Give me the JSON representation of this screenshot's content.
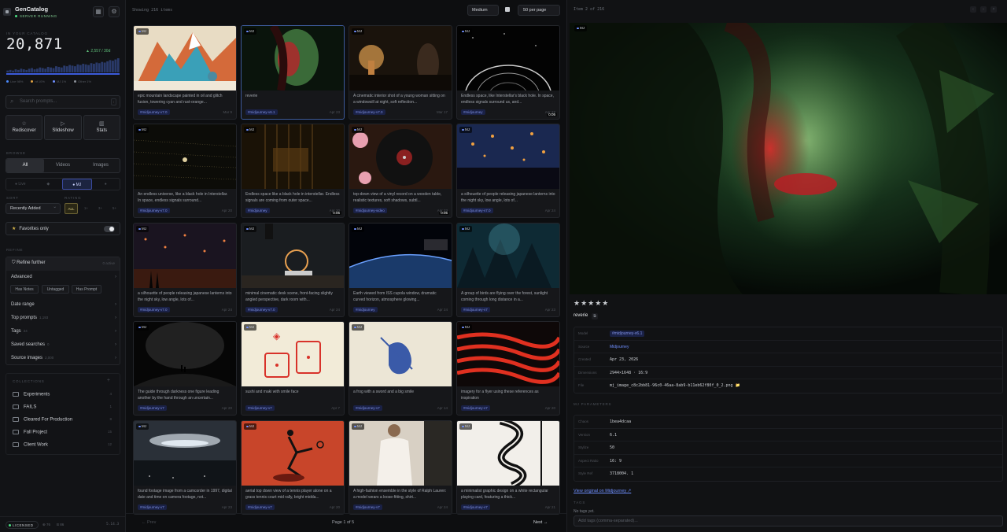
{
  "sidebar": {
    "app_name": "GenCatalog",
    "server_status": "SERVER RUNNING",
    "catalog_label": "IN YOUR CATALOG",
    "count": "20,871",
    "delta": "▲ 2,557 / 30d",
    "legend": [
      "Live 98%",
      "nf 10%",
      "MJ 1%",
      "Other 1%"
    ],
    "legend_colors": [
      "#4b8bff",
      "#e0a040",
      "#6f8fff",
      "#8a8f97"
    ],
    "sparkline": [
      3,
      4,
      3,
      5,
      4,
      6,
      5,
      4,
      6,
      7,
      5,
      6,
      8,
      7,
      6,
      9,
      8,
      7,
      10,
      9,
      8,
      11,
      10,
      12,
      11,
      10,
      13,
      12,
      14,
      13,
      12,
      15,
      14,
      16,
      15,
      17,
      16,
      18,
      20,
      19,
      21,
      23
    ],
    "search_placeholder": "Search prompts...",
    "search_kbd": "/",
    "tiles": [
      {
        "icon": "☆",
        "label": "Rediscover"
      },
      {
        "icon": "▷",
        "label": "Slideshow"
      },
      {
        "icon": "▥",
        "label": "Stats"
      }
    ],
    "browse_label": "BROWSE",
    "types": [
      "All",
      "Videos",
      "Images"
    ],
    "sources": [
      "● Live",
      "◆",
      "● MJ",
      "●"
    ],
    "sort_label": "SORT",
    "sort_value": "Recently Added",
    "rating_label": "RATING",
    "ratings": [
      "ALL",
      "1+",
      "3+",
      "5+"
    ],
    "favorites_label": "Favorites only",
    "refine_label": "REFINE",
    "refine": {
      "title": "Refine further",
      "active": "0 active",
      "advanced": "Advanced",
      "chips": [
        "Has Notes",
        "Untagged",
        "Has Prompt"
      ],
      "rows": [
        {
          "label": "Date range",
          "n": ""
        },
        {
          "label": "Top prompts",
          "n": "1,193"
        },
        {
          "label": "Tags",
          "n": "24"
        },
        {
          "label": "Saved searches",
          "n": "0"
        },
        {
          "label": "Source images",
          "n": "2,000"
        }
      ]
    },
    "collections_label": "COLLECTIONS",
    "collections": [
      {
        "name": "Experiments",
        "n": "4"
      },
      {
        "name": "FAILS",
        "n": "1"
      },
      {
        "name": "Cleared For Production",
        "n": "8"
      },
      {
        "name": "Fall Project",
        "n": "15"
      },
      {
        "name": "Client Work",
        "n": "12"
      }
    ],
    "license": "LICENSED",
    "stats": [
      "⊕ 76",
      "B 86"
    ],
    "version": "5.14.3"
  },
  "main": {
    "showing": "Showing 216 items",
    "size": "Medium",
    "per_page": "50 per page",
    "cards": [
      {
        "caption": "epic mountain landscape painted in oil and glitch fusion, towering cyan and rust-orange...",
        "tag": "#midjourney-v7.0",
        "date": "Mar 9",
        "bg": "a",
        "dur": ""
      },
      {
        "caption": "reverie",
        "tag": "#midjourney-v6.1",
        "date": "Apr 23",
        "bg": "b",
        "dur": ""
      },
      {
        "caption": "A cinematic interior shot of a young woman sitting on a windowsill at night, soft reflection...",
        "tag": "#midjourney-v7.0",
        "date": "Mar 17",
        "bg": "c",
        "dur": ""
      },
      {
        "caption": "Endless space, like Interstellar's black hole. In space, endless signals surround us, and...",
        "tag": "#midjourney",
        "date": "Apr 22",
        "bg": "d",
        "dur": "0:05"
      },
      {
        "caption": "An endless universe, like a black hole in Interstellar. In space, endless signals surround...",
        "tag": "#midjourney-v7.0",
        "date": "Apr 20",
        "bg": "e",
        "dur": ""
      },
      {
        "caption": "Endless space like a black hole in interstellar. Endless signals are coming from outer space...",
        "tag": "#midjourney",
        "date": "Apr 20",
        "bg": "f",
        "dur": "0:05"
      },
      {
        "caption": "top-down view of a vinyl record on a wooden table, realistic textures, soft shadows, subtl...",
        "tag": "#midjourney-video",
        "date": "Apr 23",
        "bg": "g",
        "dur": "0:05"
      },
      {
        "caption": "a silhouette of people releasing japanese lanterns into the night sky, low angle, lots of...",
        "tag": "#midjourney-v7.0",
        "date": "Apr 24",
        "bg": "h",
        "dur": ""
      },
      {
        "caption": "a silhouette of people releasing japanese lanterns into the night sky, low angle, lots of...",
        "tag": "#midjourney-v7.0",
        "date": "Apr 24",
        "bg": "i",
        "dur": ""
      },
      {
        "caption": "minimal cinematic desk scene, front-facing slightly angled perspective, dark room with...",
        "tag": "#midjourney-v7.0",
        "date": "Apr 24",
        "bg": "j",
        "dur": ""
      },
      {
        "caption": "Earth viewed from ISS cupola window, dramatic curved horizon, atmosphere glowing...",
        "tag": "#midjourney",
        "date": "Apr 24",
        "bg": "k",
        "dur": ""
      },
      {
        "caption": "A group of birds are flying over the forest, sunlight coming through long distance in a...",
        "tag": "#midjourney-v7",
        "date": "Apr 23",
        "bg": "l",
        "dur": ""
      },
      {
        "caption": "The guide through darkness one figure leading another by the hand through an uncertain...",
        "tag": "#midjourney-v7",
        "date": "Apr 20",
        "bg": "m",
        "dur": ""
      },
      {
        "caption": "sushi and maki with smile face",
        "tag": "#midjourney-v7",
        "date": "Apr 7",
        "bg": "n",
        "dur": ""
      },
      {
        "caption": "a frog with a sword and a big smile",
        "tag": "#midjourney-v7",
        "date": "Apr 14",
        "bg": "o",
        "dur": ""
      },
      {
        "caption": "imagery for a flyer using these references as inspiration",
        "tag": "#midjourney-v7",
        "date": "Apr 20",
        "bg": "p",
        "dur": ""
      },
      {
        "caption": "found footage image from a camcorder in 1997, digital date and time on camera footage, not...",
        "tag": "#midjourney-v7",
        "date": "Apr 23",
        "bg": "q",
        "dur": ""
      },
      {
        "caption": "aerial top down view of a tennis player alone on a grass tennis court mid rally, bright midda...",
        "tag": "#midjourney-v7",
        "date": "Apr 20",
        "bg": "r",
        "dur": ""
      },
      {
        "caption": "A high-fashion ensemble in the style of Ralph Lauren: a model wears a loose-fitting, shirt...",
        "tag": "#midjourney-v7",
        "date": "Apr 24",
        "bg": "s",
        "dur": ""
      },
      {
        "caption": "a minimalist graphic design on a white rectangular playing card, featuring a thick...",
        "tag": "#midjourney-v7",
        "date": "Apr 21",
        "bg": "t",
        "dur": ""
      }
    ],
    "pager": {
      "prev": "← Prev",
      "info": "Page 1 of 5",
      "next": "Next →"
    }
  },
  "detail": {
    "position": "Item 2 of 216",
    "badge": "MJ",
    "stars": "★★★★★",
    "title": "reverie",
    "meta": [
      {
        "k": "Model",
        "v": "#midjourney-v6.1",
        "kind": "tag"
      },
      {
        "k": "Source",
        "v": "Midjourney",
        "kind": "link"
      },
      {
        "k": "Created",
        "v": "Apr 23, 2026",
        "kind": "text"
      },
      {
        "k": "Dimensions",
        "v": "2944×1648 · 16:9",
        "kind": "text"
      },
      {
        "k": "File",
        "v": "mj_image_c8c2bb81-96c0-46aa-8ab9-b11eb62f80f_0_2.png 📁",
        "kind": "text"
      }
    ],
    "params_label": "MJ PARAMETERS",
    "params": [
      {
        "k": "Chaos",
        "v": "1bea4dcaa"
      },
      {
        "k": "Version",
        "v": "6.1"
      },
      {
        "k": "Stylize",
        "v": "50"
      },
      {
        "k": "Aspect Ratio",
        "v": "16: 9"
      },
      {
        "k": "Style Ref",
        "v": "3718004. 1"
      }
    ],
    "view_original": "View original on Midjourney ↗",
    "tags_label": "TAGS",
    "no_tags": "No tags yet.",
    "add_tags_placeholder": "Add tags (comma-separated)..."
  }
}
